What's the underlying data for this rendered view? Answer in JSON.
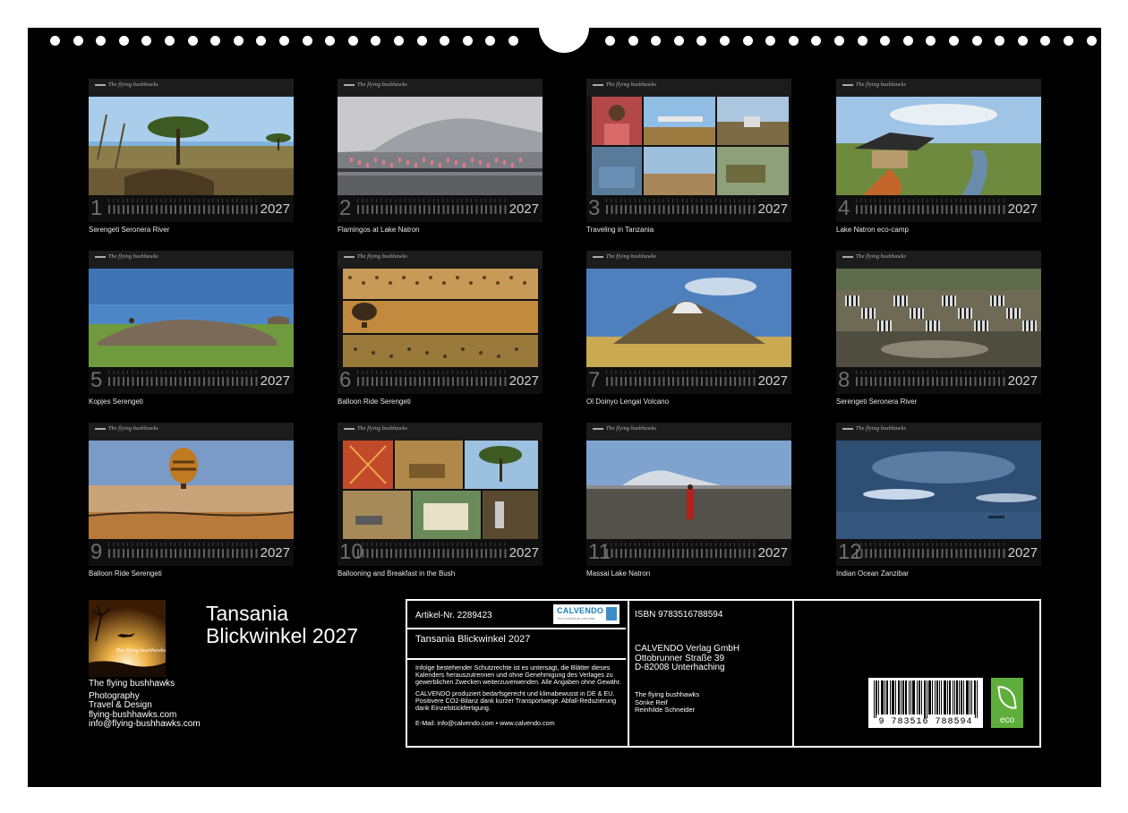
{
  "title": {
    "line1": "Tansania",
    "line2": "Blickwinkel 2027"
  },
  "months": [
    {
      "num": "1",
      "year": "2027",
      "caption": "Serengeti Seronera River"
    },
    {
      "num": "2",
      "year": "2027",
      "caption": "Flamingos at Lake Natron"
    },
    {
      "num": "3",
      "year": "2027",
      "caption": "Traveling in Tanzania"
    },
    {
      "num": "4",
      "year": "2027",
      "caption": "Lake Natron eco-camp"
    },
    {
      "num": "5",
      "year": "2027",
      "caption": "Kopjes Serengeti"
    },
    {
      "num": "6",
      "year": "2027",
      "caption": "Balloon Ride Serengeti"
    },
    {
      "num": "7",
      "year": "2027",
      "caption": "Ol Doinyo Lengai Volcano"
    },
    {
      "num": "8",
      "year": "2027",
      "caption": "Serengeti Seronera River"
    },
    {
      "num": "9",
      "year": "2027",
      "caption": "Balloon Ride Serengeti"
    },
    {
      "num": "10",
      "year": "2027",
      "caption": "Ballooning and Breakfast in the Bush"
    },
    {
      "num": "11",
      "year": "2027",
      "caption": "Massai Lake Natron"
    },
    {
      "num": "12",
      "year": "2027",
      "caption": "Indian Ocean Zanzibar"
    }
  ],
  "photo_logo": "The flying bushhawks",
  "author": {
    "name": "The flying bushhawks",
    "role1": "Photography",
    "role2": "Travel & Design",
    "web": "flying-bushhawks.com",
    "email": "info@flying-bushhawks.com"
  },
  "info": {
    "artikel": "Artikel-Nr. 2289423",
    "product": "Tansania Blickwinkel 2027",
    "legal1": "Infolge bestehender Schutzrechte ist es untersagt, die Blätter dieses Kalenders herauszutrennen und ohne Genehmigung des Verlages zu gewerblichen Zwecken weiterzuverwenden. Alle Angaben ohne Gewähr.",
    "legal2": "CALVENDO produziert bedarfsgerecht und klimabewusst in DE & EU. Positivere CO2-Bilanz dank kurzer Transportwege. Abfall-Reduzierung dank Einzelstückfertigung.",
    "contact": "E-Mail: info@calvendo.com • www.calvendo.com",
    "isbn": "ISBN 9783516788594",
    "publisher1": "CALVENDO Verlag GmbH",
    "publisher2": "Ottobrunner Straße 39",
    "publisher3": "D-82008 Unterhaching",
    "credit1": "The flying bushhawks",
    "credit2": "Sönke Reif",
    "credit3": "Reinhilde Schneider",
    "calvendo_logo": "CALVENDO",
    "calvendo_sub": "Your individual calendar",
    "barcode_number": "9 783516 788594",
    "eco_label": "eco"
  }
}
